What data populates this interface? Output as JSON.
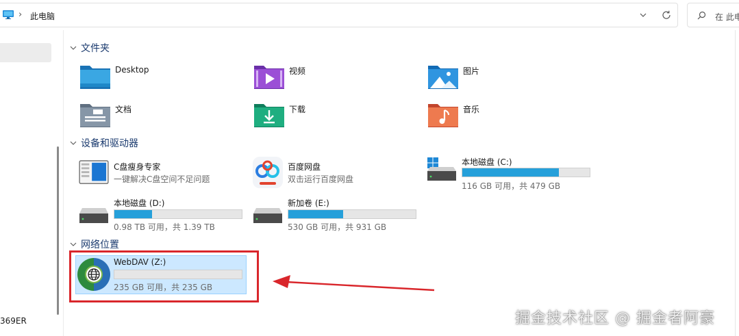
{
  "address": {
    "crumb": "此电脑",
    "separator": "›"
  },
  "search": {
    "placeholder": "在 此电"
  },
  "nav": {
    "last_item": "369ER"
  },
  "sections": {
    "folders": {
      "label": "文件夹"
    },
    "devices": {
      "label": "设备和驱动器"
    },
    "network": {
      "label": "网络位置"
    }
  },
  "folders": [
    {
      "name": "Desktop",
      "icon": "desktop-folder-icon"
    },
    {
      "name": "视频",
      "icon": "videos-folder-icon"
    },
    {
      "name": "图片",
      "icon": "pictures-folder-icon"
    },
    {
      "name": "文档",
      "icon": "documents-folder-icon"
    },
    {
      "name": "下载",
      "icon": "downloads-folder-icon"
    },
    {
      "name": "音乐",
      "icon": "music-folder-icon"
    }
  ],
  "apps": [
    {
      "name": "C盘瘦身专家",
      "desc": "一键解决C盘空间不足问题"
    },
    {
      "name": "百度网盘",
      "desc": "双击运行百度网盘"
    }
  ],
  "drives": {
    "c": {
      "name": "本地磁盘 (C:)",
      "usage": "116 GB 可用，共 479 GB",
      "used_fraction": 0.758
    },
    "d": {
      "name": "本地磁盘 (D:)",
      "usage": "0.98 TB 可用，共 1.39 TB",
      "used_fraction": 0.295
    },
    "e": {
      "name": "新加卷 (E:)",
      "usage": "530 GB 可用，共 931 GB",
      "used_fraction": 0.43
    }
  },
  "network_drive": {
    "name": "WebDAV (Z:)",
    "usage": "235 GB 可用，共 235 GB",
    "used_fraction": 0.0
  },
  "watermark": "掘金技术社区 @ 掘金者阿豪",
  "colors": {
    "progress": "#26a0da",
    "highlight": "#cce8ff",
    "annotation": "#d9262b"
  }
}
